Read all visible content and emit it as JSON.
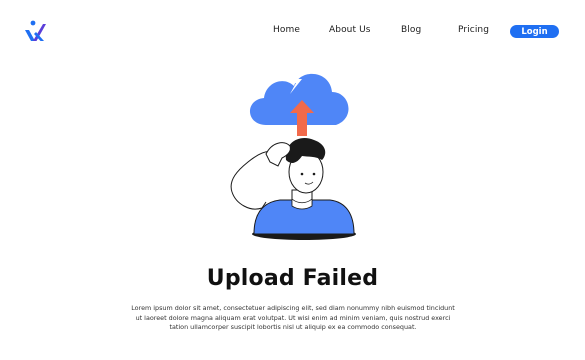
{
  "colors": {
    "accent": "#1f6ff2",
    "cloud": "#4f86f7",
    "arrow": "#f26a4b",
    "shirt": "#4f86f7",
    "logo_primary": "#1f6ff2",
    "logo_secondary": "#5b3fd9"
  },
  "header": {
    "logo_icon": "brand-logo-icon",
    "nav": [
      {
        "label": "Home"
      },
      {
        "label": "About Us"
      },
      {
        "label": "Blog"
      },
      {
        "label": "Pricing"
      }
    ],
    "login_label": "Login"
  },
  "main": {
    "illustration_icon": "upload-failed-illustration",
    "title": "Upload Failed",
    "description": "Lorem ipsum dolor sit amet, consectetuer adipiscing elit, sed diam nonummy nibh euismod tincidunt ut laoreet dolore magna aliquam erat volutpat. Ut wisi enim ad minim veniam, quis nostrud exerci tation ullamcorper suscipit lobortis nisl ut aliquip ex ea commodo consequat."
  }
}
